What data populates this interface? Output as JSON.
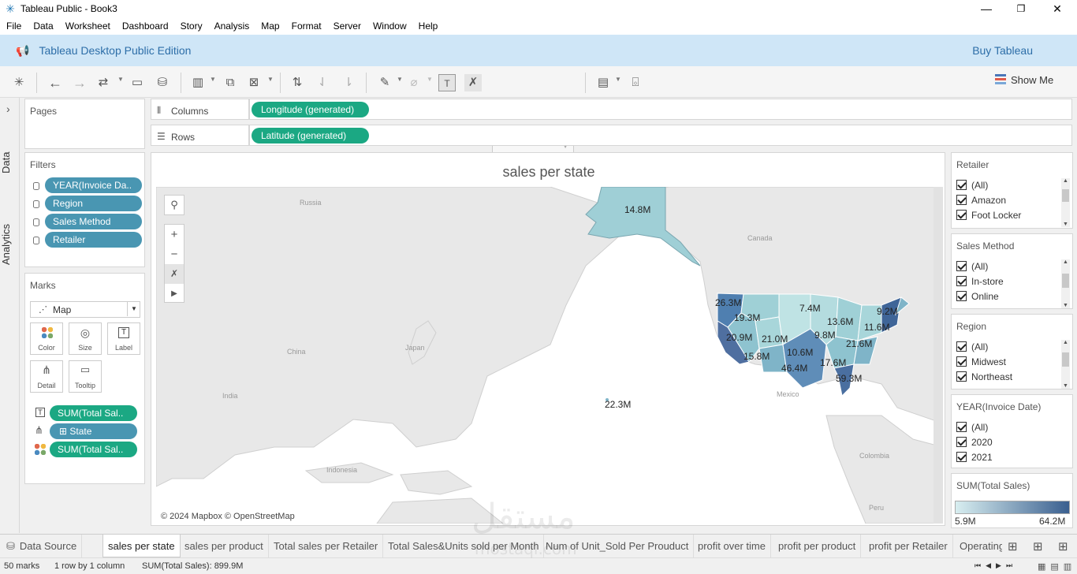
{
  "window": {
    "title": "Tableau Public - Book3",
    "minimize": "—",
    "maximize": "❐",
    "close": "✕"
  },
  "menu": [
    "File",
    "Data",
    "Worksheet",
    "Dashboard",
    "Story",
    "Analysis",
    "Map",
    "Format",
    "Server",
    "Window",
    "Help"
  ],
  "banner": {
    "edition": "Tableau Desktop Public Edition",
    "buy": "Buy Tableau"
  },
  "toolbar": {
    "show_me": "Show Me"
  },
  "side_tabs": {
    "data": "Data",
    "analytics": "Analytics",
    "expand": "›"
  },
  "pages": {
    "title": "Pages"
  },
  "filters": {
    "title": "Filters",
    "items": [
      "YEAR(Invoice Da..",
      "Region",
      "Sales Method",
      "Retailer"
    ]
  },
  "marks": {
    "title": "Marks",
    "type": "Map",
    "buttons": [
      "Color",
      "Size",
      "Label",
      "Detail",
      "Tooltip"
    ],
    "fields": [
      {
        "icon": "label-icon",
        "name": "SUM(Total Sal.."
      },
      {
        "icon": "detail-icon",
        "name": "State"
      },
      {
        "icon": "color-icon",
        "name": "SUM(Total Sal.."
      }
    ]
  },
  "shelves": {
    "columns_label": "Columns",
    "columns_pill": "Longitude (generated)",
    "rows_label": "Rows",
    "rows_pill": "Latitude (generated)"
  },
  "view": {
    "title": "sales per state",
    "attribution": "© 2024 Mapbox © OpenStreetMap",
    "map_labels": [
      "Russia",
      "Canada",
      "China",
      "Japan",
      "India",
      "Mexico",
      "Indonesia",
      "Colombia",
      "Peru"
    ],
    "value_labels": [
      "14.8M",
      "26.3M",
      "7.4M",
      "9.2M",
      "19.3M",
      "13.6M",
      "11.6M",
      "20.9M",
      "21.0M",
      "9.8M",
      "21.6M",
      "10.6M",
      "15.8M",
      "17.6M",
      "46.4M",
      "59.3M",
      "22.3M"
    ]
  },
  "legends": {
    "retailer": {
      "title": "Retailer",
      "options": [
        "(All)",
        "Amazon",
        "Foot Locker"
      ]
    },
    "sales_method": {
      "title": "Sales Method",
      "options": [
        "(All)",
        "In-store",
        "Online"
      ]
    },
    "region": {
      "title": "Region",
      "options": [
        "(All)",
        "Midwest",
        "Northeast"
      ]
    },
    "year": {
      "title": "YEAR(Invoice Date)",
      "options": [
        "(All)",
        "2020",
        "2021"
      ]
    },
    "color": {
      "title": "SUM(Total Sales)",
      "min": "5.9M",
      "max": "64.2M",
      "color_low": "#d8eef0",
      "color_high": "#3a5f8f"
    }
  },
  "sheet_tabs": [
    "Data Source",
    "sales per state",
    "sales per product",
    "Total sales per Retailer",
    "Total Sales&Units sold per Month",
    "Num of Unit_Sold Per Prouduct",
    "profit over time",
    "profit per product",
    "profit per Retailer",
    "Operating"
  ],
  "status": {
    "marks": "50 marks",
    "rows": "1 row by 1 column",
    "sum": "SUM(Total Sales): 899.9M"
  },
  "watermark": {
    "arabic": "مستقل",
    "latin": "mostaql.com"
  }
}
